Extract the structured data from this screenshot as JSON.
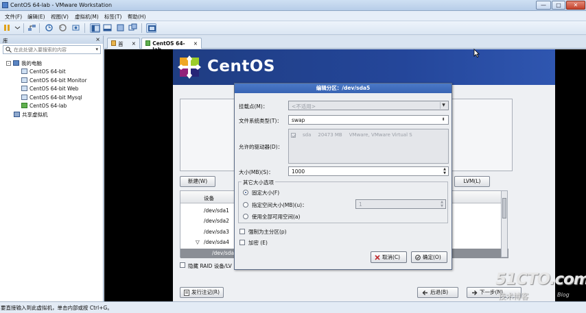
{
  "window": {
    "title": "CentOS 64-lab - VMware Workstation",
    "min": "—",
    "max": "□",
    "close": "✕"
  },
  "menu": [
    {
      "label": "文件(F)"
    },
    {
      "label": "编辑(E)"
    },
    {
      "label": "视图(V)"
    },
    {
      "label": "虚拟机(M)"
    },
    {
      "label": "标签(T)"
    },
    {
      "label": "帮助(H)"
    }
  ],
  "library": {
    "title": "库",
    "close": "×",
    "search_placeholder": "在此处键入要搜索的内容",
    "dropdown": "▾",
    "root": "我的电脑",
    "root_expander": "-",
    "vms": [
      "CentOS 64-bit",
      "CentOS 64-bit Monitor",
      "CentOS 64-bit Web",
      "CentOS 64-bit Mysql",
      "CentOS 64-lab"
    ],
    "shared": "共享虚拟机"
  },
  "tabs": [
    {
      "label": "首页",
      "close": "×"
    },
    {
      "label": "CentOS 64-lab",
      "close": "×"
    }
  ],
  "guest": {
    "brand": "CentOS",
    "buttons": {
      "new": "新建(W)",
      "lvm": "LVM(L)",
      "release_notes": "发行注记(R)",
      "back": "后退(B)",
      "next": "下一步(N)"
    },
    "table_header": "设备",
    "devices": [
      "/dev/sda1",
      "/dev/sda2",
      "/dev/sda3",
      "/dev/sda4",
      "/dev/sda5"
    ],
    "expander": "▽",
    "hide_raid": "隐藏 RAID 设备/LV"
  },
  "dialog": {
    "title": "编辑分区：/dev/sda5",
    "mount_label": "挂载点(M)：",
    "mount_value": "<不适用>",
    "fstype_label": "文件系统类型(T)：",
    "fstype_value": "swap",
    "drives_label": "允许的驱动器(D)：",
    "drive_row": {
      "name": "sda",
      "size": "20473 MB",
      "model": "VMware, VMware Virtual S"
    },
    "size_label": "大小(MB)(S)：",
    "size_value": "1000",
    "other_options": "其它大小选项",
    "fixed": "固定大小(F)",
    "fill_to": "指定空间大小(MB)(u)：",
    "fill_to_value": "1",
    "fill_all": "使用全部可用空间(a)",
    "primary": "强制为主分区(p)",
    "encrypt": "加密 (E)",
    "cancel": "取消(C)",
    "ok": "确定(O)"
  },
  "status": {
    "message": "要直接输入到此虚拟机，单击内部或按 Ctrl+G。"
  },
  "watermark": {
    "line1": "51CTO.com",
    "line2": "技术博客",
    "line3": "Blog"
  },
  "colors": {
    "banner": "#24469a",
    "dialog_title": "#3763b3",
    "selected_row": "#8a8e95"
  }
}
